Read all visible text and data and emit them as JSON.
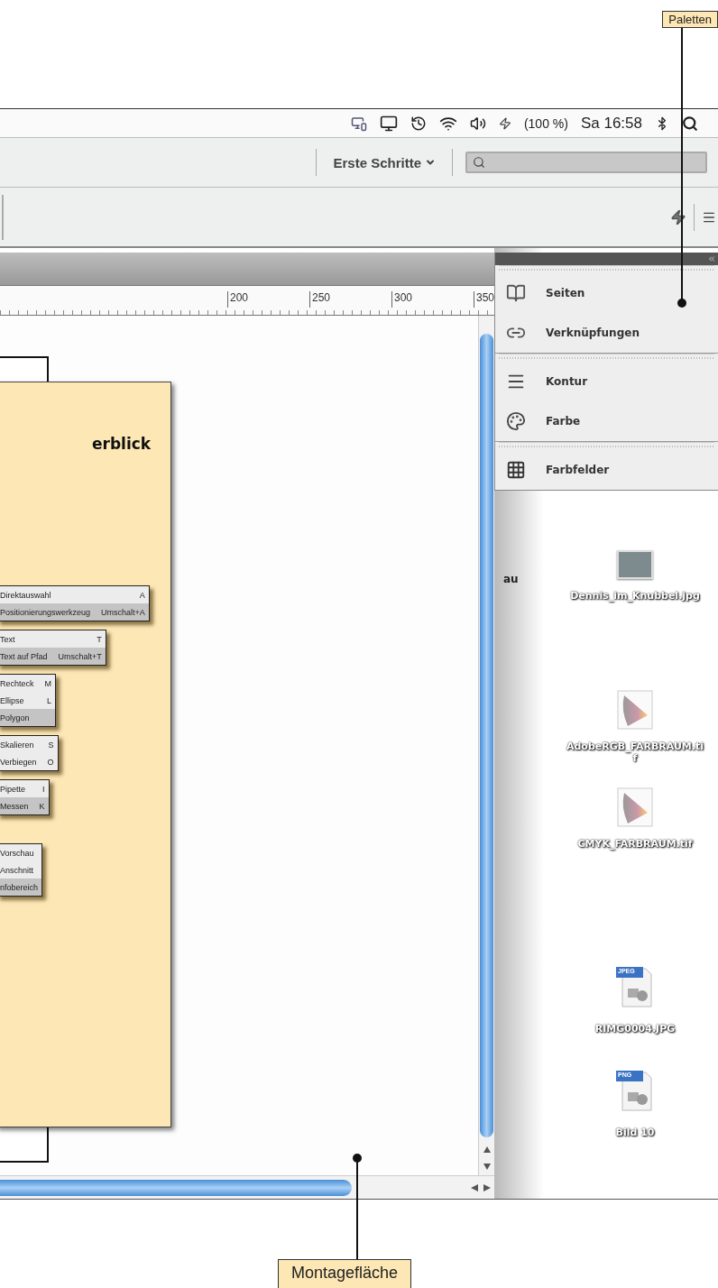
{
  "callouts": [
    {
      "label": "Paletten"
    },
    {
      "label": "Montagefläche"
    }
  ],
  "menubar": {
    "battery": "(100 %)",
    "clock": "Sa 16:58"
  },
  "appbar": {
    "workspace": "Erste Schritte"
  },
  "ruler": {
    "labels": [
      "200",
      "250",
      "300",
      "350"
    ]
  },
  "document": {
    "heading": "erblick",
    "menus": [
      [
        {
          "label": "Direktauswahl",
          "shortcut": "A",
          "selected": false
        },
        {
          "label": "Positionierungswerkzeug",
          "shortcut": "Umschalt+A",
          "selected": true
        }
      ],
      [
        {
          "label": "Text",
          "shortcut": "T",
          "selected": false
        },
        {
          "label": "Text auf Pfad",
          "shortcut": "Umschalt+T",
          "selected": true
        }
      ],
      [
        {
          "label": "Rechteck",
          "shortcut": "M",
          "selected": false
        },
        {
          "label": "Ellipse",
          "shortcut": "L",
          "selected": false
        },
        {
          "label": "Polygon",
          "selected": true
        }
      ],
      [
        {
          "label": "Skalieren",
          "shortcut": "S",
          "selected": false
        },
        {
          "label": "Verbiegen",
          "shortcut": "O",
          "selected": false
        }
      ],
      [
        {
          "label": "Pipette",
          "shortcut": "I",
          "selected": false
        },
        {
          "label": "Messen",
          "shortcut": "K",
          "selected": true
        }
      ],
      [
        {
          "label": "Vorschau",
          "selected": false
        },
        {
          "label": "Anschnitt",
          "selected": false
        },
        {
          "label": "nfobereich",
          "selected": true
        }
      ]
    ]
  },
  "panels": [
    [
      {
        "label": "Seiten",
        "kind": "pages"
      },
      {
        "label": "Verknüpfungen",
        "kind": "links"
      }
    ],
    [
      {
        "label": "Kontur",
        "kind": "stroke"
      },
      {
        "label": "Farbe",
        "kind": "color"
      }
    ],
    [
      {
        "label": "Farbfelder",
        "kind": "swatches"
      }
    ]
  ],
  "desktop": {
    "cut_label": "au",
    "files": [
      {
        "name": "Dennis_im_Knubbel.jpg",
        "kind": "photo"
      },
      {
        "name": "AdobeRGB_FARBRAUM.tif",
        "kind": "profile"
      },
      {
        "name": "CMYK_FARBRAUM.tif",
        "kind": "profile"
      },
      {
        "name": "RIMG0004.JPG",
        "kind": "document",
        "badge": "JPEG"
      },
      {
        "name": "Bild 10",
        "kind": "document",
        "badge": "PNG"
      }
    ]
  }
}
